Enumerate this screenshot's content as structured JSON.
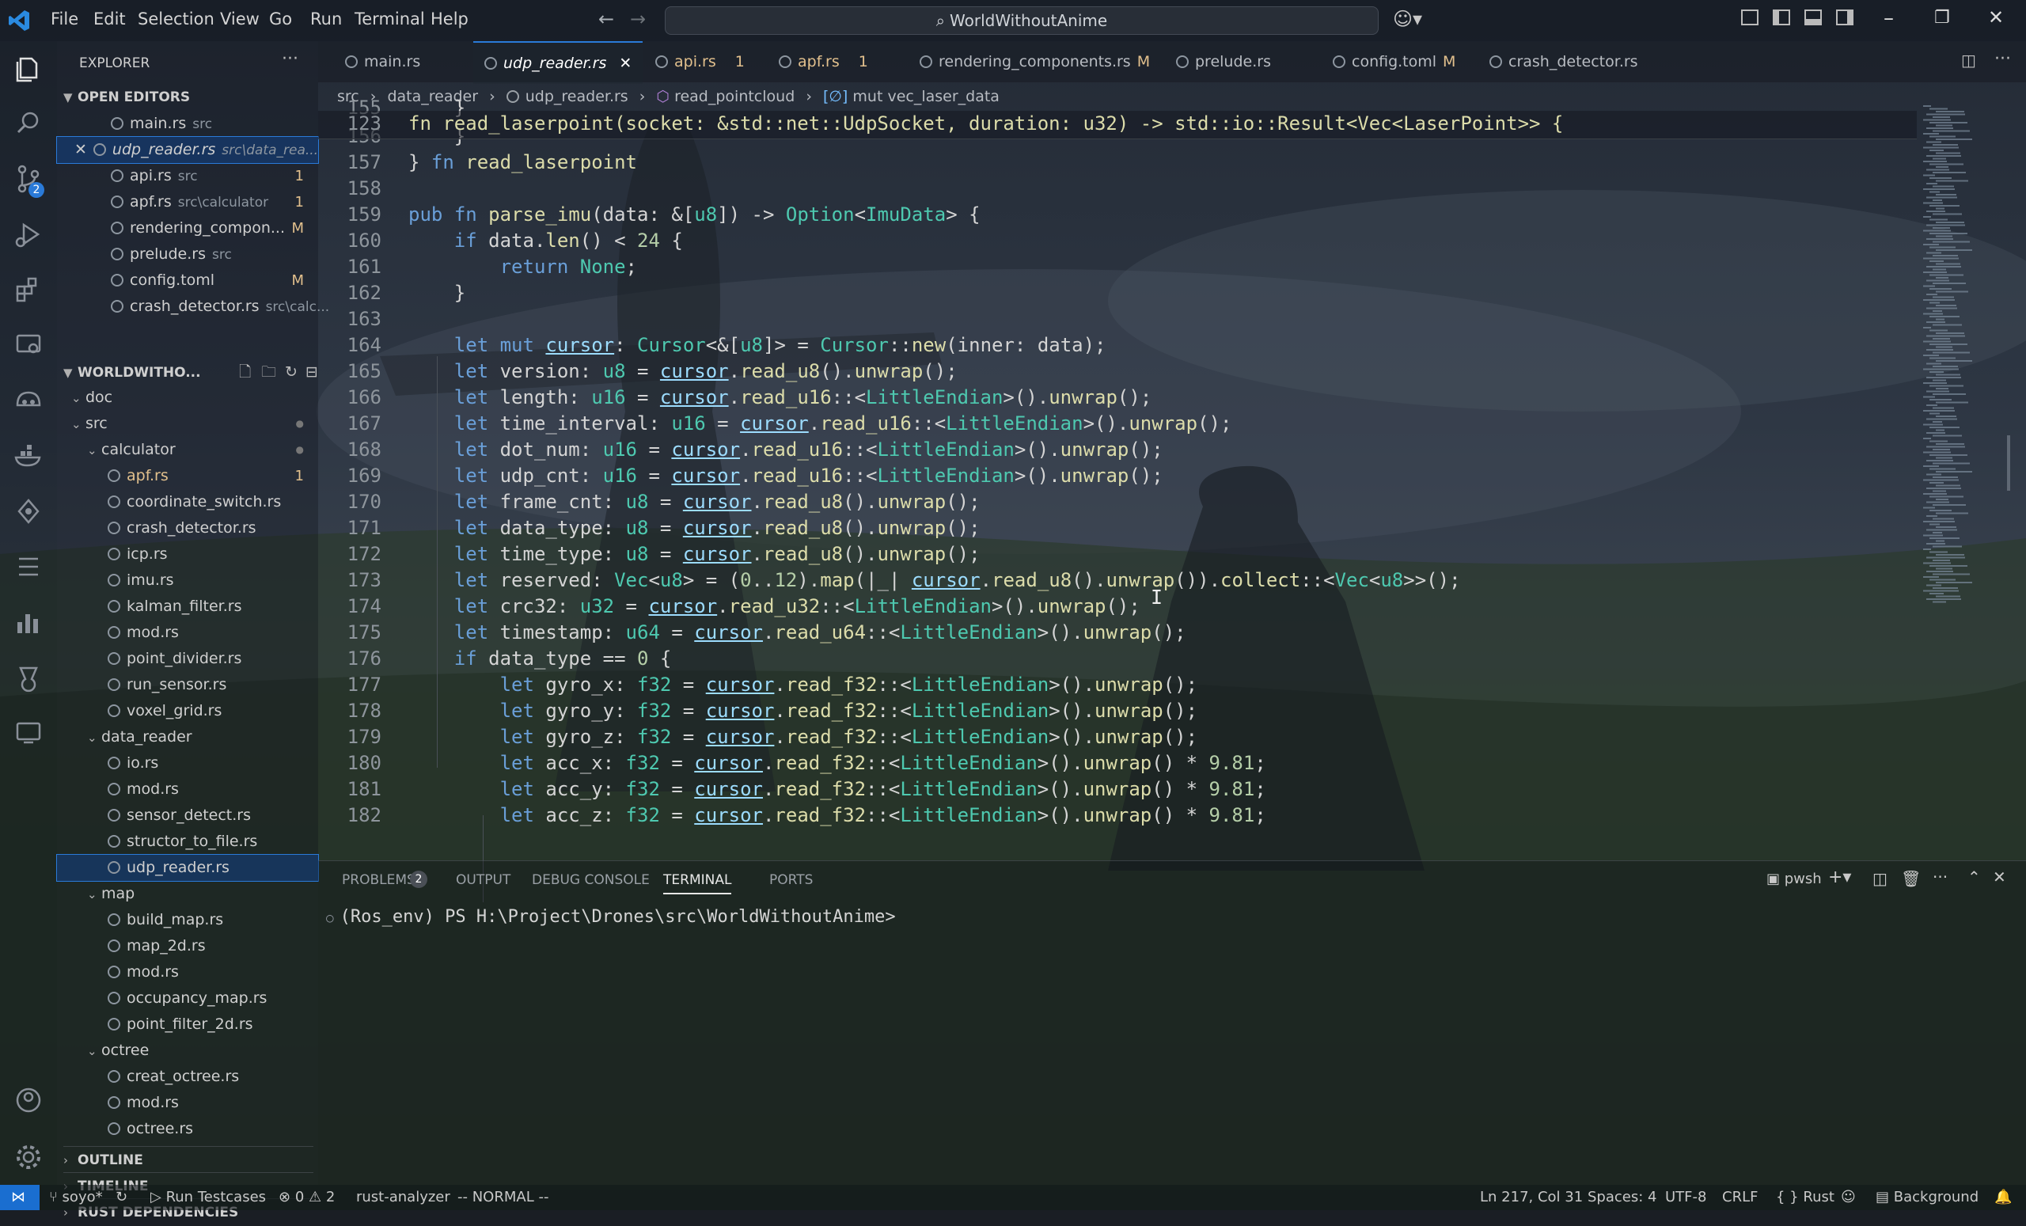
{
  "menu": [
    "File",
    "Edit",
    "Selection",
    "View",
    "Go",
    "Run",
    "Terminal",
    "Help"
  ],
  "search": {
    "text": "WorldWithoutAnime"
  },
  "activity_badge": "2",
  "explorer": {
    "title": "EXPLORER",
    "open_editors_title": "OPEN EDITORS",
    "open_editors": [
      {
        "name": "main.rs",
        "path": "src",
        "badge": ""
      },
      {
        "name": "udp_reader.rs",
        "path": "src\\data_rea...",
        "badge": ""
      },
      {
        "name": "api.rs",
        "path": "src",
        "badge": "1"
      },
      {
        "name": "apf.rs",
        "path": "src\\calculator",
        "badge": "1"
      },
      {
        "name": "rendering_compon...",
        "path": "",
        "badge": "M"
      },
      {
        "name": "prelude.rs",
        "path": "src",
        "badge": ""
      },
      {
        "name": "config.toml",
        "path": "",
        "badge": "M"
      },
      {
        "name": "crash_detector.rs",
        "path": "src\\calc...",
        "badge": ""
      }
    ],
    "workspace_title": "WORLDWITHO...",
    "tree": [
      {
        "label": "doc",
        "kind": "folder",
        "level": 0
      },
      {
        "label": "src",
        "kind": "folder",
        "level": 0
      },
      {
        "label": "calculator",
        "kind": "folder",
        "level": 1
      },
      {
        "label": "apf.rs",
        "kind": "file",
        "level": 2,
        "badge": "1"
      },
      {
        "label": "coordinate_switch.rs",
        "kind": "file",
        "level": 2
      },
      {
        "label": "crash_detector.rs",
        "kind": "file",
        "level": 2
      },
      {
        "label": "icp.rs",
        "kind": "file",
        "level": 2
      },
      {
        "label": "imu.rs",
        "kind": "file",
        "level": 2
      },
      {
        "label": "kalman_filter.rs",
        "kind": "file",
        "level": 2
      },
      {
        "label": "mod.rs",
        "kind": "file",
        "level": 2
      },
      {
        "label": "point_divider.rs",
        "kind": "file",
        "level": 2
      },
      {
        "label": "run_sensor.rs",
        "kind": "file",
        "level": 2
      },
      {
        "label": "voxel_grid.rs",
        "kind": "file",
        "level": 2
      },
      {
        "label": "data_reader",
        "kind": "folder",
        "level": 1
      },
      {
        "label": "io.rs",
        "kind": "file",
        "level": 2
      },
      {
        "label": "mod.rs",
        "kind": "file",
        "level": 2
      },
      {
        "label": "sensor_detect.rs",
        "kind": "file",
        "level": 2
      },
      {
        "label": "structor_to_file.rs",
        "kind": "file",
        "level": 2
      },
      {
        "label": "udp_reader.rs",
        "kind": "file",
        "level": 2,
        "selected": true
      },
      {
        "label": "map",
        "kind": "folder",
        "level": 1
      },
      {
        "label": "build_map.rs",
        "kind": "file",
        "level": 2
      },
      {
        "label": "map_2d.rs",
        "kind": "file",
        "level": 2
      },
      {
        "label": "mod.rs",
        "kind": "file",
        "level": 2
      },
      {
        "label": "occupancy_map.rs",
        "kind": "file",
        "level": 2
      },
      {
        "label": "point_filter_2d.rs",
        "kind": "file",
        "level": 2
      },
      {
        "label": "octree",
        "kind": "folder",
        "level": 1
      },
      {
        "label": "creat_octree.rs",
        "kind": "file",
        "level": 2
      },
      {
        "label": "mod.rs",
        "kind": "file",
        "level": 2
      },
      {
        "label": "octree.rs",
        "kind": "file",
        "level": 2
      }
    ],
    "sections": [
      "OUTLINE",
      "TIMELINE",
      "RUST DEPENDENCIES"
    ]
  },
  "tabs": [
    {
      "label": "main.rs",
      "num": "",
      "mod": ""
    },
    {
      "label": "udp_reader.rs",
      "num": "",
      "mod": "",
      "active": true
    },
    {
      "label": "api.rs",
      "num": "1",
      "mod": ""
    },
    {
      "label": "apf.rs",
      "num": "1",
      "mod": ""
    },
    {
      "label": "rendering_components.rs",
      "num": "",
      "mod": "M"
    },
    {
      "label": "prelude.rs",
      "num": "",
      "mod": ""
    },
    {
      "label": "config.toml",
      "num": "",
      "mod": "M"
    },
    {
      "label": "crash_detector.rs",
      "num": "",
      "mod": ""
    }
  ],
  "breadcrumb": [
    "src",
    "data_reader",
    "udp_reader.rs",
    "read_pointcloud",
    "mut vec_laser_data"
  ],
  "sticky": {
    "line": "123",
    "code": "fn read_laserpoint(socket: &std::net::UdpSocket, duration: u32) -> std::io::Result<Vec<LaserPoint>> {"
  },
  "code_lines": [
    {
      "n": "155",
      "t": "    }"
    },
    {
      "n": "156",
      "t": "    }"
    },
    {
      "n": "157",
      "t": "} fn read_laserpoint"
    },
    {
      "n": "158",
      "t": ""
    },
    {
      "n": "159",
      "t": "pub fn parse_imu(data: &[u8]) -> Option<ImuData> {"
    },
    {
      "n": "160",
      "t": "    if data.len() < 24 {"
    },
    {
      "n": "161",
      "t": "        return None;"
    },
    {
      "n": "162",
      "t": "    }"
    },
    {
      "n": "163",
      "t": ""
    },
    {
      "n": "164",
      "t": "    let mut cursor: Cursor<&[u8]> = Cursor::new(inner: data);"
    },
    {
      "n": "165",
      "t": "    let version: u8 = cursor.read_u8().unwrap();"
    },
    {
      "n": "166",
      "t": "    let length: u16 = cursor.read_u16::<LittleEndian>().unwrap();"
    },
    {
      "n": "167",
      "t": "    let time_interval: u16 = cursor.read_u16::<LittleEndian>().unwrap();"
    },
    {
      "n": "168",
      "t": "    let dot_num: u16 = cursor.read_u16::<LittleEndian>().unwrap();"
    },
    {
      "n": "169",
      "t": "    let udp_cnt: u16 = cursor.read_u16::<LittleEndian>().unwrap();"
    },
    {
      "n": "170",
      "t": "    let frame_cnt: u8 = cursor.read_u8().unwrap();"
    },
    {
      "n": "171",
      "t": "    let data_type: u8 = cursor.read_u8().unwrap();"
    },
    {
      "n": "172",
      "t": "    let time_type: u8 = cursor.read_u8().unwrap();"
    },
    {
      "n": "173",
      "t": "    let reserved: Vec<u8> = (0..12).map(|_| cursor.read_u8().unwrap()).collect::<Vec<u8>>();"
    },
    {
      "n": "174",
      "t": "    let crc32: u32 = cursor.read_u32::<LittleEndian>().unwrap();"
    },
    {
      "n": "175",
      "t": "    let timestamp: u64 = cursor.read_u64::<LittleEndian>().unwrap();"
    },
    {
      "n": "176",
      "t": "    if data_type == 0 {"
    },
    {
      "n": "177",
      "t": "        let gyro_x: f32 = cursor.read_f32::<LittleEndian>().unwrap();"
    },
    {
      "n": "178",
      "t": "        let gyro_y: f32 = cursor.read_f32::<LittleEndian>().unwrap();"
    },
    {
      "n": "179",
      "t": "        let gyro_z: f32 = cursor.read_f32::<LittleEndian>().unwrap();"
    },
    {
      "n": "180",
      "t": "        let acc_x: f32 = cursor.read_f32::<LittleEndian>().unwrap() * 9.81;"
    },
    {
      "n": "181",
      "t": "        let acc_y: f32 = cursor.read_f32::<LittleEndian>().unwrap() * 9.81;"
    },
    {
      "n": "182",
      "t": "        let acc_z: f32 = cursor.read_f32::<LittleEndian>().unwrap() * 9.81;"
    }
  ],
  "panel": {
    "tabs": [
      "PROBLEMS",
      "OUTPUT",
      "DEBUG CONSOLE",
      "TERMINAL",
      "PORTS"
    ],
    "problems_count": "2",
    "shell": "pwsh",
    "terminal_line": "(Ros_env) PS H:\\Project\\Drones\\src\\WorldWithoutAnime>"
  },
  "status": {
    "branch": "soyo*",
    "run": "Run Testcases",
    "errors": "0",
    "warnings": "2",
    "analyzer": "rust-analyzer",
    "mode": "-- NORMAL --",
    "position": "Ln 217, Col 31",
    "spaces": "Spaces: 4",
    "encoding": "UTF-8",
    "eol": "CRLF",
    "lang": "Rust",
    "background": "Background"
  },
  "colors": {
    "accent": "#2a7ad8",
    "keyword": "#6a9fd8",
    "function": "#dcdcaa",
    "type": "#4ec9b0",
    "variable": "#9cdcfe",
    "modified": "#e2c08d"
  }
}
